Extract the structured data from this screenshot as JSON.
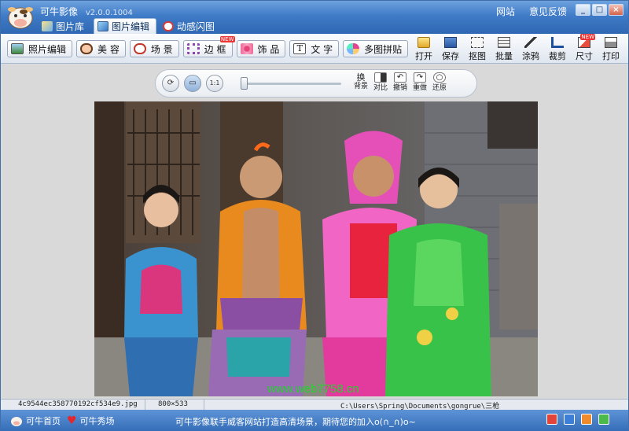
{
  "window": {
    "app_name": "可牛影像",
    "version": "v2.0.0.1004",
    "links": [
      "网站",
      "意见反馈"
    ],
    "buttons": [
      "minimize",
      "maximize",
      "close"
    ]
  },
  "tabs": [
    {
      "label": "图片库",
      "icon": "gallery-icon",
      "active": false
    },
    {
      "label": "图片编辑",
      "icon": "image-edit-icon",
      "active": true
    },
    {
      "label": "动感闪图",
      "icon": "flash-icon",
      "active": false
    }
  ],
  "toolbar": {
    "left": [
      {
        "label": "照片编辑",
        "icon": "photo-edit-icon"
      },
      {
        "label": "美 容",
        "icon": "beauty-icon"
      },
      {
        "label": "场 景",
        "icon": "scene-icon"
      },
      {
        "label": "边 框",
        "icon": "frame-icon"
      },
      {
        "label": "饰 品",
        "icon": "accessory-icon"
      },
      {
        "label": "文 字",
        "icon": "text-icon"
      },
      {
        "label": "多图拼贴",
        "icon": "collage-icon"
      }
    ],
    "right": [
      {
        "label": "打开",
        "icon": "open-icon"
      },
      {
        "label": "保存",
        "icon": "save-icon"
      },
      {
        "label": "抠图",
        "icon": "cutout-icon"
      },
      {
        "label": "批量",
        "icon": "batch-icon"
      },
      {
        "label": "涂鸦",
        "icon": "doodle-icon"
      },
      {
        "label": "裁剪",
        "icon": "crop-icon"
      },
      {
        "label": "尺寸",
        "icon": "resize-icon"
      },
      {
        "label": "打印",
        "icon": "print-icon"
      }
    ],
    "badges": [
      "NEW",
      "NEW"
    ]
  },
  "edit_bar": {
    "circle_buttons": [
      "rotate",
      "fit-screen",
      "1:1"
    ],
    "circle_one_to_one": "1:1",
    "zoom_fraction": 0.0,
    "buttons": [
      {
        "label": "背景",
        "top": "换"
      },
      {
        "label": "对比",
        "top": ""
      },
      {
        "label": "撤销",
        "top": ""
      },
      {
        "label": "重做",
        "top": ""
      },
      {
        "label": "还原",
        "top": ""
      }
    ]
  },
  "photo": {
    "watermark": "www.web7758.cn"
  },
  "status": {
    "filename": "4c9544ec358770192cf534e9.jpg",
    "dimensions": "800×533",
    "path": "C:\\Users\\Spring\\Documents\\gongrue\\三枪"
  },
  "bottom": {
    "home": "可牛首页",
    "show": "可牛秀场",
    "message": "可牛影像联手威客网站打造高清场景，期待您的加入o(∩_∩)o~"
  },
  "colors": {
    "title_bar": "#3f7bc7",
    "bottom_bar": "#356eb8",
    "accent_red": "#e33333"
  }
}
